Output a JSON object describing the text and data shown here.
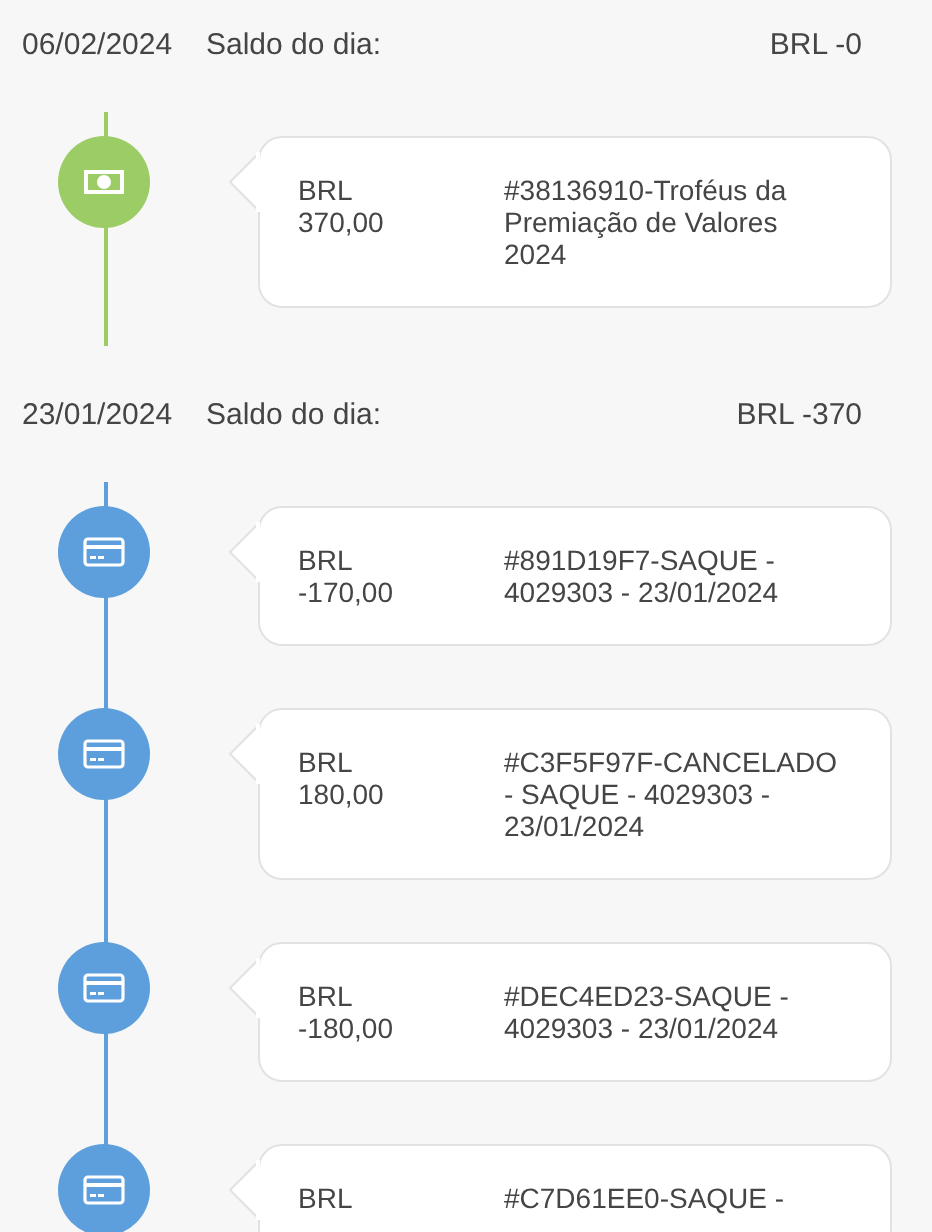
{
  "days": [
    {
      "date": "06/02/2024",
      "balance_label": "Saldo do dia:",
      "balance": "BRL -0",
      "entries": [
        {
          "kind": "money",
          "currency": "BRL",
          "amount": "370,00",
          "description": "#38136910-Troféus da Premiação de Valores 2024"
        }
      ]
    },
    {
      "date": "23/01/2024",
      "balance_label": "Saldo do dia:",
      "balance": "BRL -370",
      "entries": [
        {
          "kind": "card",
          "currency": "BRL",
          "amount": "-170,00",
          "description": "#891D19F7-SAQUE - 4029303 - 23/01/2024"
        },
        {
          "kind": "card",
          "currency": "BRL",
          "amount": "180,00",
          "description": "#C3F5F97F-CANCELADO - SAQUE - 4029303 - 23/01/2024"
        },
        {
          "kind": "card",
          "currency": "BRL",
          "amount": "-180,00",
          "description": "#DEC4ED23-SAQUE - 4029303 - 23/01/2024"
        },
        {
          "kind": "card",
          "currency": "BRL",
          "description": "#C7D61EE0-SAQUE -"
        }
      ]
    }
  ]
}
